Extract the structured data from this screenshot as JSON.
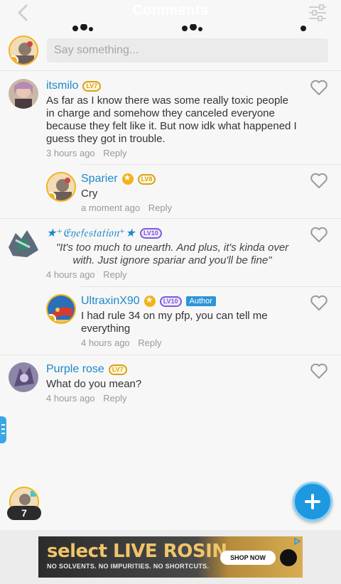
{
  "header": {
    "title": "Comments"
  },
  "composer": {
    "placeholder": "Say something..."
  },
  "comments": [
    {
      "username": "itsmilo",
      "level": "LV7",
      "text": "As far as I know there was some really toxic people in charge and somehow they canceled everyone because they felt like it. But now idk what happened I guess they got in trouble.",
      "time": "3 hours ago",
      "reply": "Reply"
    },
    {
      "username": "Sparier",
      "level": "LV8",
      "text": "Cry",
      "time": "a moment ago",
      "reply": "Reply"
    },
    {
      "username": "★⁺𝔈𝔶𝔢𝔣𝔢𝔰𝔱𝔞𝔱𝔦𝔬𝔫⁺★",
      "level": "LV10",
      "text": "\"It's too much to unearth. And plus, it's kinda over with. Just ignore spariar and you'll be fine\"",
      "time": "4 hours ago",
      "reply": "Reply"
    },
    {
      "username": "UltraxinX90",
      "level": "LV10",
      "badge": "Author",
      "text": "I had rule 34 on my pfp, you can tell me everything",
      "time": "4 hours ago",
      "reply": "Reply"
    },
    {
      "username": "Purple rose",
      "level": "LV7",
      "text": "What do you mean?",
      "time": "4 hours ago",
      "reply": "Reply"
    }
  ],
  "online": {
    "count": "7"
  },
  "ad": {
    "headline": "select LIVE ROSIN",
    "subline": "NO SOLVENTS. NO IMPURITIES. NO SHORTCUTS.",
    "cta": "SHOP NOW"
  },
  "colors": {
    "accent": "#1e88c8",
    "gold": "#f3b21a",
    "purple": "#7c5bd6",
    "fab": "#1e98e0"
  }
}
